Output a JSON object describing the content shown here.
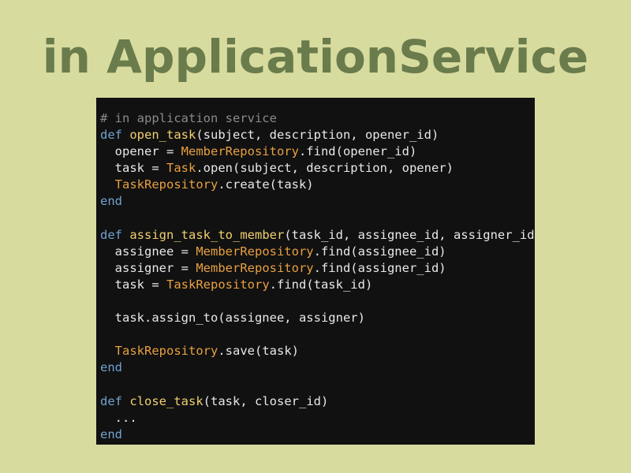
{
  "slide": {
    "title": "in ApplicationService"
  },
  "colors": {
    "background": "#d7db9e",
    "title": "#6a7b4c",
    "code_background": "#111111",
    "comment": "#8a8a8a",
    "keyword": "#6fa3d0",
    "function_name": "#f0d070",
    "constant": "#e8a040",
    "text": "#e8e8e8"
  },
  "code": {
    "lines": [
      [
        {
          "t": "comment",
          "v": "# in application service"
        }
      ],
      [
        {
          "t": "keyword",
          "v": "def"
        },
        {
          "t": "plain",
          "v": " "
        },
        {
          "t": "func",
          "v": "open_task"
        },
        {
          "t": "plain",
          "v": "(subject, description, opener_id)"
        }
      ],
      [
        {
          "t": "plain",
          "v": "  opener = "
        },
        {
          "t": "const",
          "v": "MemberRepository"
        },
        {
          "t": "plain",
          "v": ".find(opener_id)"
        }
      ],
      [
        {
          "t": "plain",
          "v": "  task = "
        },
        {
          "t": "const",
          "v": "Task"
        },
        {
          "t": "plain",
          "v": ".open(subject, description, opener)"
        }
      ],
      [
        {
          "t": "plain",
          "v": "  "
        },
        {
          "t": "const",
          "v": "TaskRepository"
        },
        {
          "t": "plain",
          "v": ".create(task)"
        }
      ],
      [
        {
          "t": "keyword",
          "v": "end"
        }
      ],
      [],
      [
        {
          "t": "keyword",
          "v": "def"
        },
        {
          "t": "plain",
          "v": " "
        },
        {
          "t": "func",
          "v": "assign_task_to_member"
        },
        {
          "t": "plain",
          "v": "(task_id, assignee_id, assigner_id)"
        }
      ],
      [
        {
          "t": "plain",
          "v": "  assignee = "
        },
        {
          "t": "const",
          "v": "MemberRepository"
        },
        {
          "t": "plain",
          "v": ".find(assignee_id)"
        }
      ],
      [
        {
          "t": "plain",
          "v": "  assigner = "
        },
        {
          "t": "const",
          "v": "MemberRepository"
        },
        {
          "t": "plain",
          "v": ".find(assigner_id)"
        }
      ],
      [
        {
          "t": "plain",
          "v": "  task = "
        },
        {
          "t": "const",
          "v": "TaskRepository"
        },
        {
          "t": "plain",
          "v": ".find(task_id)"
        }
      ],
      [],
      [
        {
          "t": "plain",
          "v": "  task.assign_to(assignee, assigner)"
        }
      ],
      [],
      [
        {
          "t": "plain",
          "v": "  "
        },
        {
          "t": "const",
          "v": "TaskRepository"
        },
        {
          "t": "plain",
          "v": ".save(task)"
        }
      ],
      [
        {
          "t": "keyword",
          "v": "end"
        }
      ],
      [],
      [
        {
          "t": "keyword",
          "v": "def"
        },
        {
          "t": "plain",
          "v": " "
        },
        {
          "t": "func",
          "v": "close_task"
        },
        {
          "t": "plain",
          "v": "(task, closer_id)"
        }
      ],
      [
        {
          "t": "plain",
          "v": "  ..."
        }
      ],
      [
        {
          "t": "keyword",
          "v": "end"
        }
      ]
    ]
  }
}
